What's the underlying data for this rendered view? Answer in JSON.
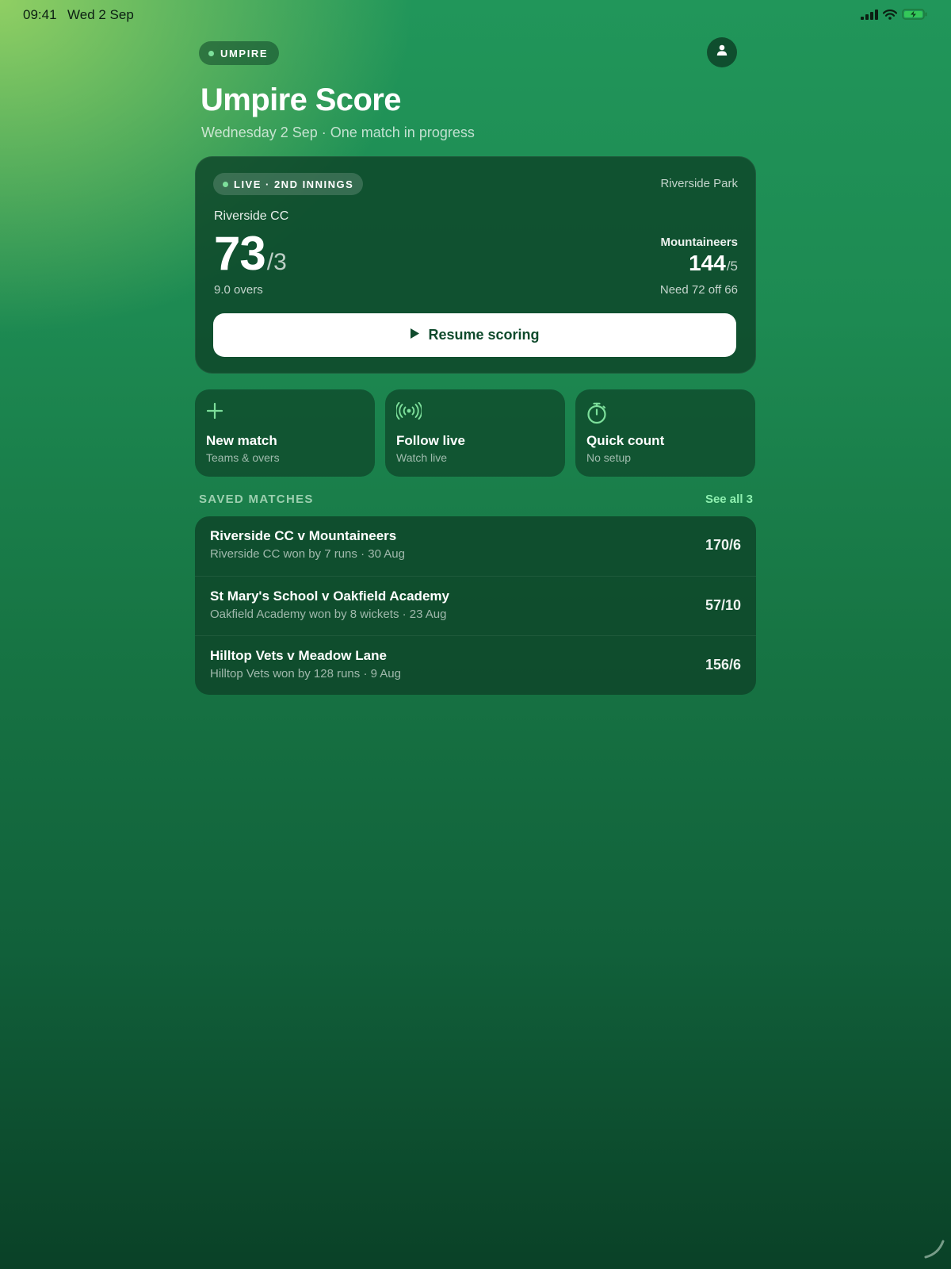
{
  "status_bar": {
    "time": "09:41",
    "date": "Wed 2 Sep"
  },
  "header": {
    "role_label": "UMPIRE",
    "title": "Umpire Score",
    "subtitle": "Wednesday 2 Sep · One match in progress",
    "profile_icon": "person-icon"
  },
  "live_match": {
    "status_label": "LIVE · 2ND INNINGS",
    "venue": "Riverside Park",
    "batting_team": "Riverside CC",
    "batting_runs": "73",
    "batting_wickets": "/3",
    "overs": "9.0 overs",
    "opponent_team": "Mountaineers",
    "opponent_runs": "144",
    "opponent_wickets": "/5",
    "target_text": "Need 72 off 66",
    "resume_label": "Resume scoring"
  },
  "actions": [
    {
      "icon": "plus-icon",
      "title": "New match",
      "subtitle": "Teams & overs"
    },
    {
      "icon": "broadcast-icon",
      "title": "Follow live",
      "subtitle": "Watch live"
    },
    {
      "icon": "stopwatch-icon",
      "title": "Quick count",
      "subtitle": "No setup"
    }
  ],
  "saved_matches": {
    "section_title": "SAVED MATCHES",
    "see_all_label": "See all 3",
    "items": [
      {
        "title": "Riverside CC v Mountaineers",
        "result": "Riverside CC won by 7 runs · 30 Aug",
        "score": "170/6"
      },
      {
        "title": "St Mary's School v Oakfield Academy",
        "result": "Oakfield Academy won by 8 wickets · 23 Aug",
        "score": "57/10"
      },
      {
        "title": "Hilltop Vets v Meadow Lane",
        "result": "Hilltop Vets won by 128 runs · 9 Aug",
        "score": "156/6"
      }
    ]
  },
  "colors": {
    "accent": "#7ddf9b",
    "link": "#8ff0b0",
    "card": "#0e4428",
    "button_text": "#0f4a2c"
  }
}
